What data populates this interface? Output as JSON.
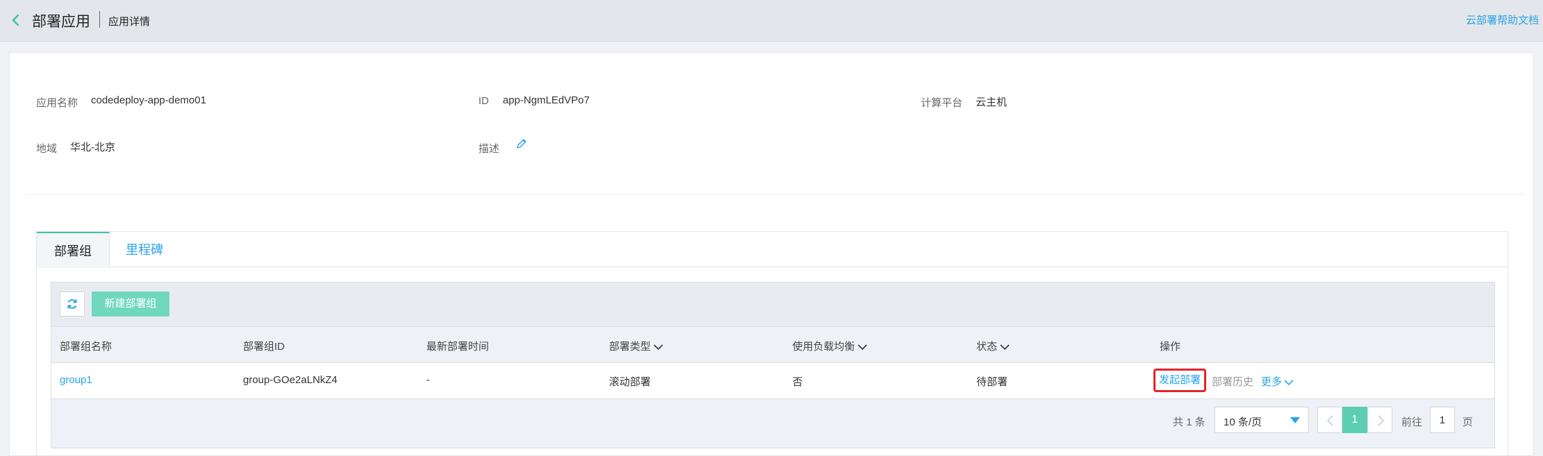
{
  "header": {
    "title": "部署应用",
    "subtitle": "应用详情",
    "help_link": "云部署帮助文档"
  },
  "info": {
    "app_name_label": "应用名称",
    "app_name_value": "codedeploy-app-demo01",
    "id_label": "ID",
    "id_value": "app-NgmLEdVPo7",
    "platform_label": "计算平台",
    "platform_value": "云主机",
    "region_label": "地域",
    "region_value": "华北-北京",
    "desc_label": "描述"
  },
  "tabs": [
    {
      "label": "部署组",
      "active": true
    },
    {
      "label": "里程碑",
      "active": false
    }
  ],
  "toolbar": {
    "new_button": "新建部署组"
  },
  "table": {
    "columns": [
      "部署组名称",
      "部署组ID",
      "最新部署时间",
      "部署类型",
      "使用负载均衡",
      "状态",
      "操作"
    ],
    "rows": [
      {
        "name": "group1",
        "id": "group-GOe2aLNkZ4",
        "last_deploy": "-",
        "type": "滚动部署",
        "load_balance": "否",
        "status": "待部署",
        "actions": {
          "deploy": "发起部署",
          "history": "部署历史",
          "more": "更多"
        }
      }
    ]
  },
  "pagination": {
    "total": "共 1 条",
    "page_size": "10 条/页",
    "current_page": "1",
    "goto_label": "前往",
    "goto_value": "1",
    "page_unit": "页"
  },
  "colors": {
    "accent": "#3fc3a5",
    "link": "#2aa4e8",
    "highlight_border": "#e4232b"
  }
}
